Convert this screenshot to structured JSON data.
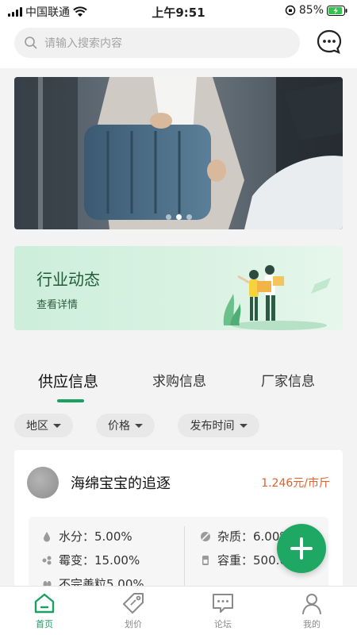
{
  "status_bar": {
    "carrier": "中国联通",
    "time": "上午9:51",
    "battery": "85%"
  },
  "search": {
    "placeholder": "请输入搜索内容"
  },
  "header": {
    "message_icon": "chat-bubble-icon"
  },
  "banner": {
    "slide_count": 3,
    "active_slide": 2
  },
  "industry_card": {
    "title": "行业动态",
    "subtitle": "查看详情"
  },
  "tabs": [
    {
      "label": "供应信息",
      "active": true
    },
    {
      "label": "求购信息",
      "active": false
    },
    {
      "label": "厂家信息",
      "active": false
    }
  ],
  "filters": [
    {
      "label": "地区"
    },
    {
      "label": "价格"
    },
    {
      "label": "发布时间"
    }
  ],
  "listing": {
    "seller": "海绵宝宝的追逐",
    "price": "1.246元/市斤",
    "specs": {
      "moisture": "水分：5.00%",
      "mildew": "霉变：15.00%",
      "imperfect": "不完善粒5.00%",
      "impurity": "杂质：6.00%",
      "bulk_density": "容重：500.00g"
    }
  },
  "colors": {
    "accent": "#1aa060",
    "price": "#e0602a",
    "fab": "#1fa864"
  },
  "bottom_nav": [
    {
      "label": "首页",
      "icon": "home-icon",
      "active": true
    },
    {
      "label": "划价",
      "icon": "price-tag-icon",
      "active": false
    },
    {
      "label": "论坛",
      "icon": "forum-icon",
      "active": false
    },
    {
      "label": "我的",
      "icon": "user-icon",
      "active": false
    }
  ]
}
